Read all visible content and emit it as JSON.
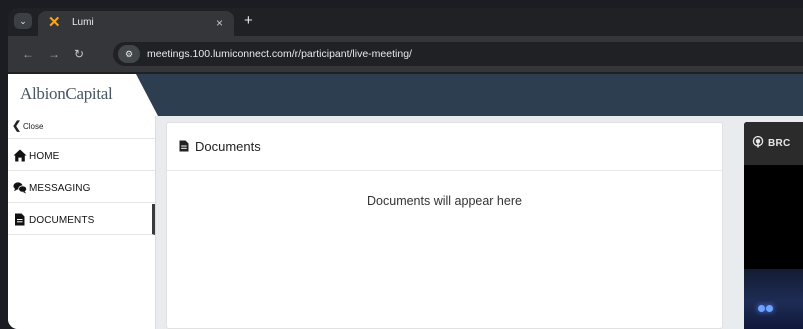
{
  "browser": {
    "tab": {
      "title": "Lumi",
      "favicon": "lumi-x-icon",
      "close_glyph": "×"
    },
    "new_tab_glyph": "+",
    "menu_glyph": "⌄",
    "url": "meetings.100.lumiconnect.com/r/participant/live-meeting/",
    "colors": {
      "tab_bg": "#35363a",
      "strip_bg": "#202124",
      "favicon": "#f5a623"
    }
  },
  "app": {
    "logo": "AlbionCapital",
    "colors": {
      "header_bg": "#2c3e4f",
      "body_bg": "#e9ecef"
    },
    "sidebar": {
      "close_label": "Close",
      "items": [
        {
          "label": "HOME",
          "icon": "home-icon",
          "active": false
        },
        {
          "label": "MESSAGING",
          "icon": "messaging-icon",
          "active": false
        },
        {
          "label": "DOCUMENTS",
          "icon": "document-icon",
          "active": true
        }
      ]
    },
    "documents": {
      "title": "Documents",
      "empty_message": "Documents will appear here"
    },
    "broadcast": {
      "label": "BRC",
      "icon": "broadcast-icon"
    }
  }
}
